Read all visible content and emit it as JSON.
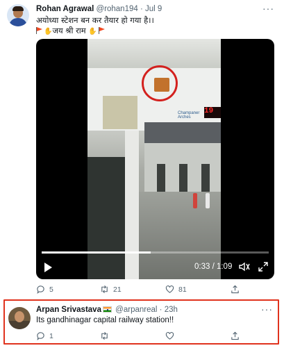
{
  "tweet": {
    "author_name": "Rohan Agrawal",
    "handle": "@rohan194",
    "separator": "·",
    "date": "Jul 9",
    "text_line1": "अयोध्या स्टेशन बन कर तैयार हो गया है।।",
    "text_line2": "जय श्री राम",
    "video": {
      "led_text": "19",
      "sign_text": "Champaner Arches",
      "time": "0:33 / 1:09",
      "progress": 0.48
    },
    "replies": "5",
    "retweets": "21",
    "likes": "81"
  },
  "reply": {
    "author_name": "Arpan Srivastava",
    "handle": "@arpanreal",
    "separator": "·",
    "date": "23h",
    "text": "Its gandhinagar capital railway station!!",
    "replies": "1"
  },
  "colors": {
    "highlight_border": "#e0321d",
    "secondary_text": "#536471"
  }
}
